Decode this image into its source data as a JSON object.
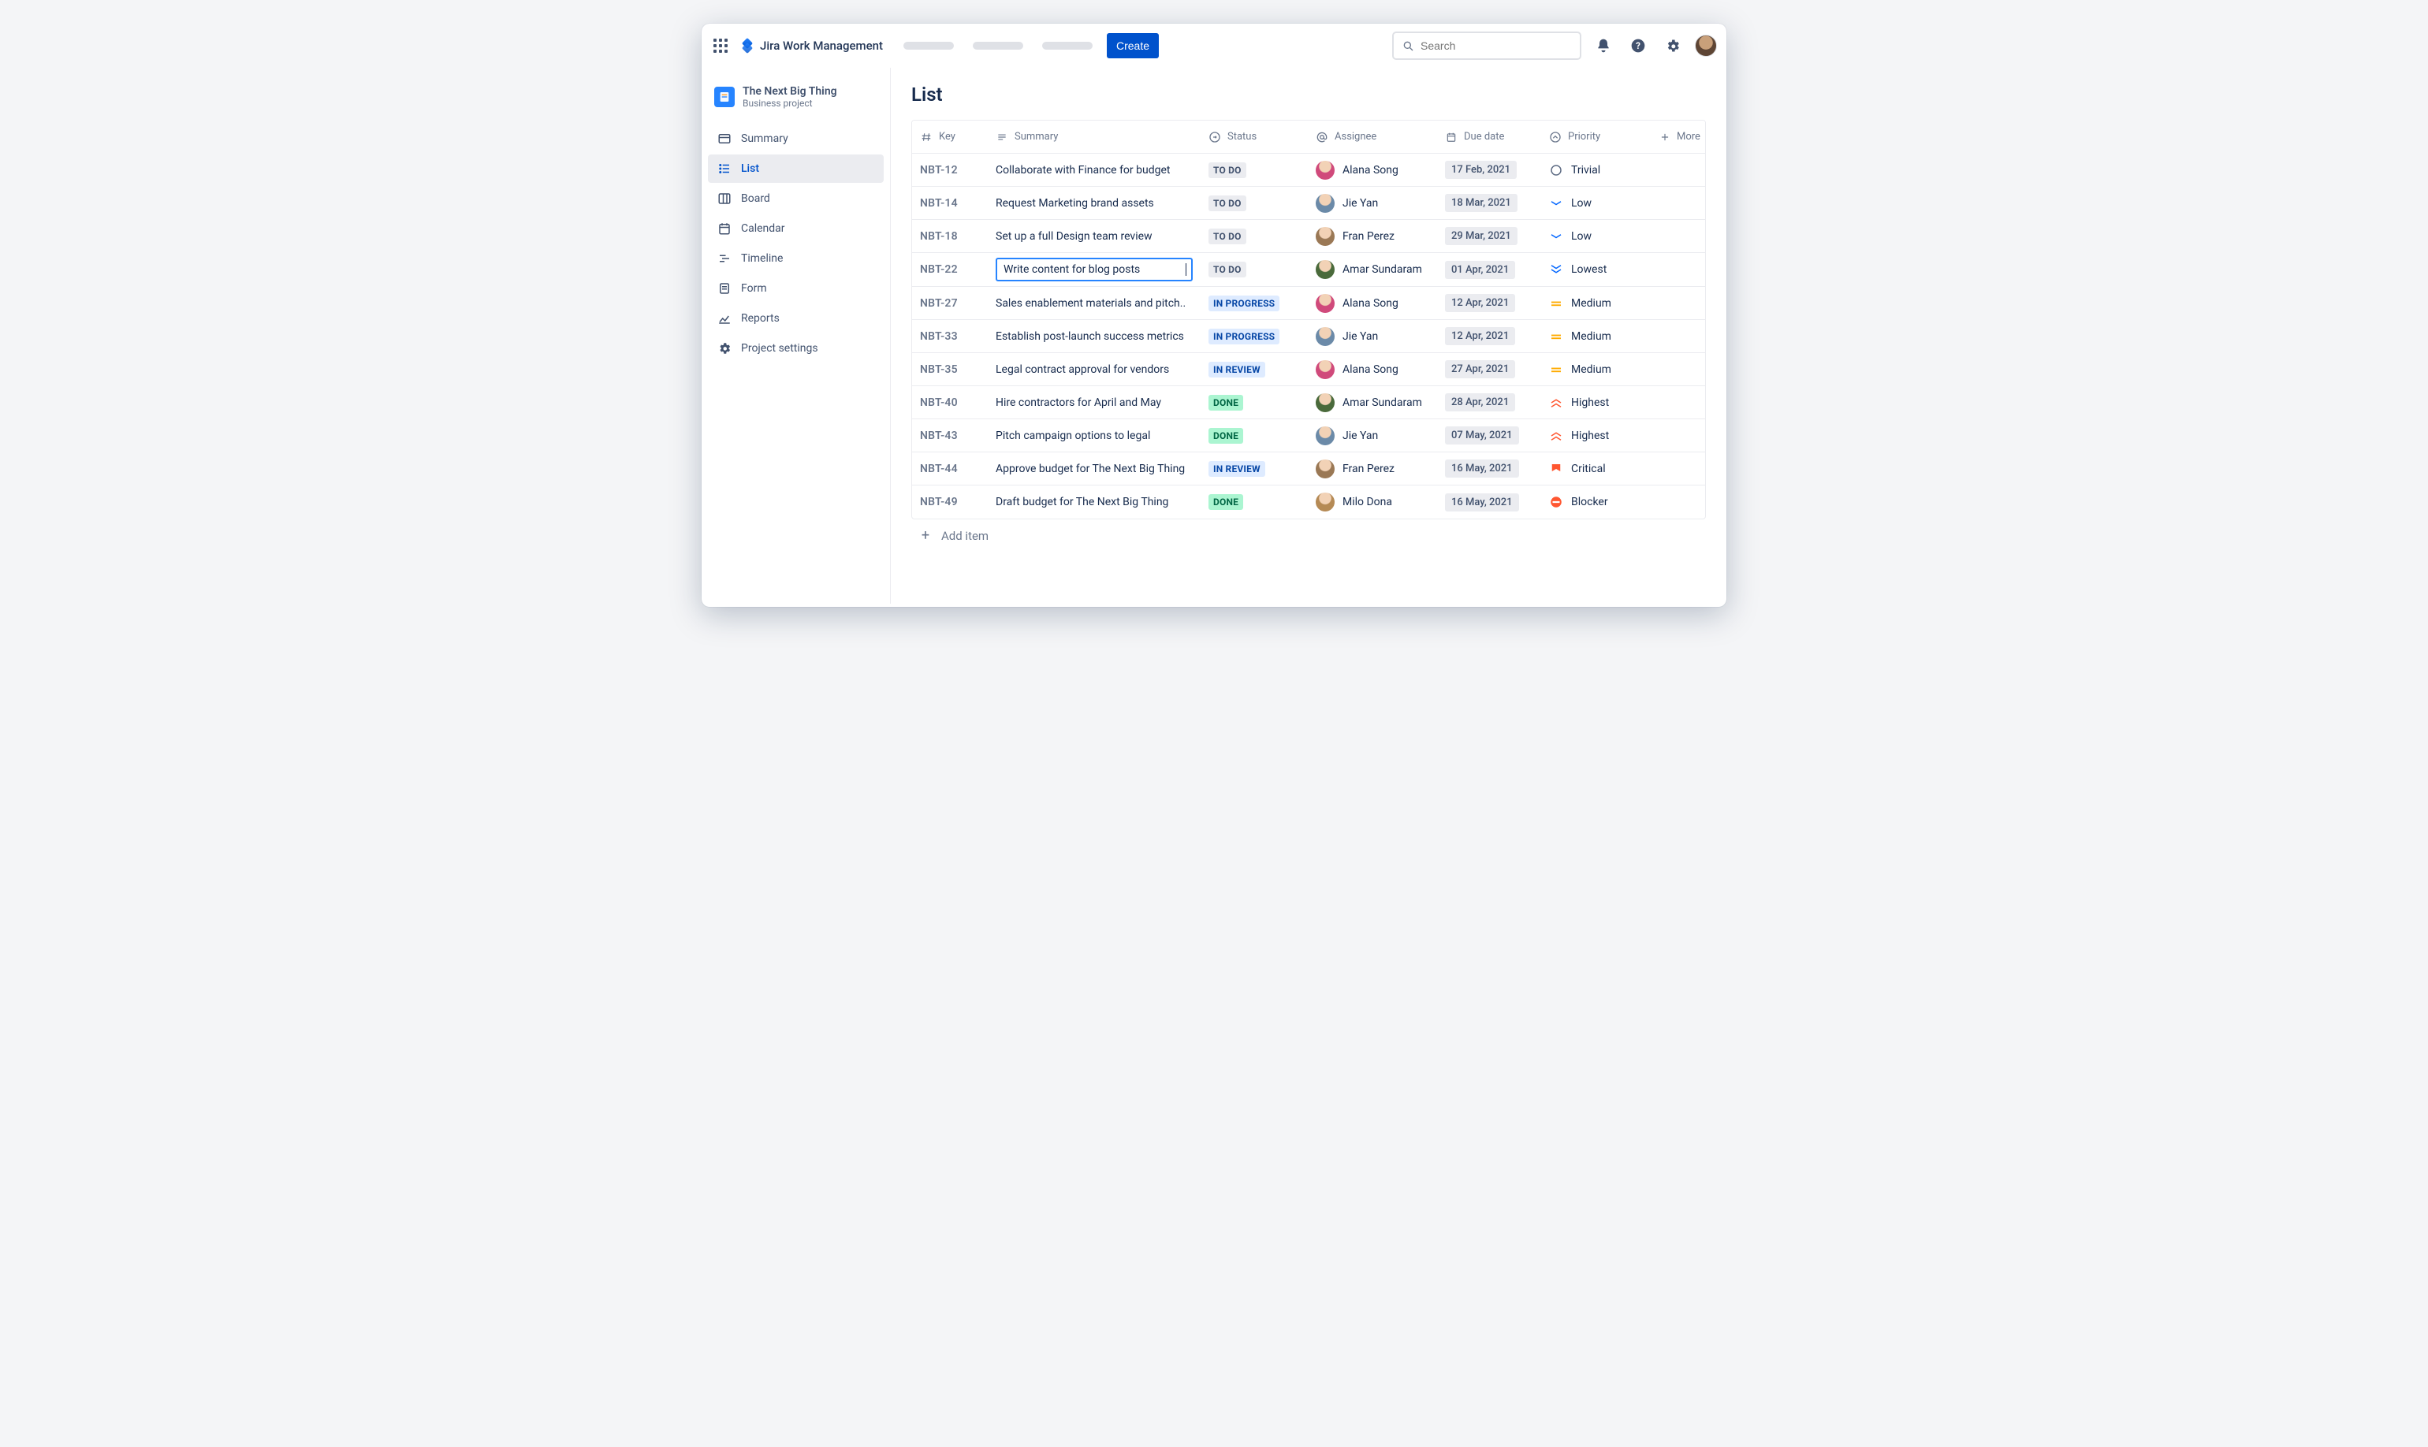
{
  "header": {
    "logo_text": "Jira Work Management",
    "create_label": "Create",
    "search_placeholder": "Search"
  },
  "project": {
    "name": "The Next Big Thing",
    "type": "Business project"
  },
  "sidebar": {
    "items": [
      {
        "label": "Summary",
        "icon": "card-icon"
      },
      {
        "label": "List",
        "icon": "list-icon",
        "active": true
      },
      {
        "label": "Board",
        "icon": "board-icon"
      },
      {
        "label": "Calendar",
        "icon": "calendar-icon"
      },
      {
        "label": "Timeline",
        "icon": "timeline-icon"
      },
      {
        "label": "Form",
        "icon": "form-icon"
      },
      {
        "label": "Reports",
        "icon": "reports-icon"
      },
      {
        "label": "Project settings",
        "icon": "gear-icon"
      }
    ]
  },
  "page": {
    "title": "List",
    "add_item_label": "Add item"
  },
  "columns": {
    "key": "Key",
    "summary": "Summary",
    "status": "Status",
    "assignee": "Assignee",
    "due": "Due date",
    "priority": "Priority",
    "more": "More"
  },
  "status_labels": {
    "todo": "TO DO",
    "inprogress": "IN PROGRESS",
    "inreview": "IN REVIEW",
    "done": "DONE"
  },
  "priority_labels": {
    "trivial": "Trivial",
    "low": "Low",
    "lowest": "Lowest",
    "medium": "Medium",
    "highest": "Highest",
    "critical": "Critical",
    "blocker": "Blocker"
  },
  "avatar_colors": {
    "Alana Song": "#d04a7b",
    "Jie Yan": "#6b8aa8",
    "Fran Perez": "#9a7855",
    "Amar Sundaram": "#4a6a3b",
    "Milo Dona": "#b58a55"
  },
  "rows": [
    {
      "key": "NBT-12",
      "summary": "Collaborate with Finance for budget",
      "status": "todo",
      "assignee": "Alana Song",
      "due": "17 Feb, 2021",
      "priority": "trivial"
    },
    {
      "key": "NBT-14",
      "summary": "Request Marketing brand assets",
      "status": "todo",
      "assignee": "Jie Yan",
      "due": "18 Mar, 2021",
      "priority": "low"
    },
    {
      "key": "NBT-18",
      "summary": "Set up a full Design team review",
      "status": "todo",
      "assignee": "Fran Perez",
      "due": "29 Mar, 2021",
      "priority": "low"
    },
    {
      "key": "NBT-22",
      "summary": "Write content for blog posts",
      "status": "todo",
      "assignee": "Amar Sundaram",
      "due": "01 Apr, 2021",
      "priority": "lowest",
      "editing": true
    },
    {
      "key": "NBT-27",
      "summary": "Sales enablement materials and pitch..",
      "status": "inprogress",
      "assignee": "Alana Song",
      "due": "12 Apr, 2021",
      "priority": "medium"
    },
    {
      "key": "NBT-33",
      "summary": "Establish post-launch success metrics",
      "status": "inprogress",
      "assignee": "Jie Yan",
      "due": "12 Apr, 2021",
      "priority": "medium"
    },
    {
      "key": "NBT-35",
      "summary": "Legal contract approval for vendors",
      "status": "inreview",
      "assignee": "Alana Song",
      "due": "27 Apr, 2021",
      "priority": "medium"
    },
    {
      "key": "NBT-40",
      "summary": "Hire contractors for April and May",
      "status": "done",
      "assignee": "Amar Sundaram",
      "due": "28 Apr, 2021",
      "priority": "highest"
    },
    {
      "key": "NBT-43",
      "summary": "Pitch campaign options to legal",
      "status": "done",
      "assignee": "Jie Yan",
      "due": "07 May, 2021",
      "priority": "highest"
    },
    {
      "key": "NBT-44",
      "summary": "Approve budget for The Next Big Thing",
      "status": "inreview",
      "assignee": "Fran Perez",
      "due": "16 May, 2021",
      "priority": "critical"
    },
    {
      "key": "NBT-49",
      "summary": "Draft budget for The Next Big Thing",
      "status": "done",
      "assignee": "Milo Dona",
      "due": "16 May, 2021",
      "priority": "blocker"
    }
  ]
}
